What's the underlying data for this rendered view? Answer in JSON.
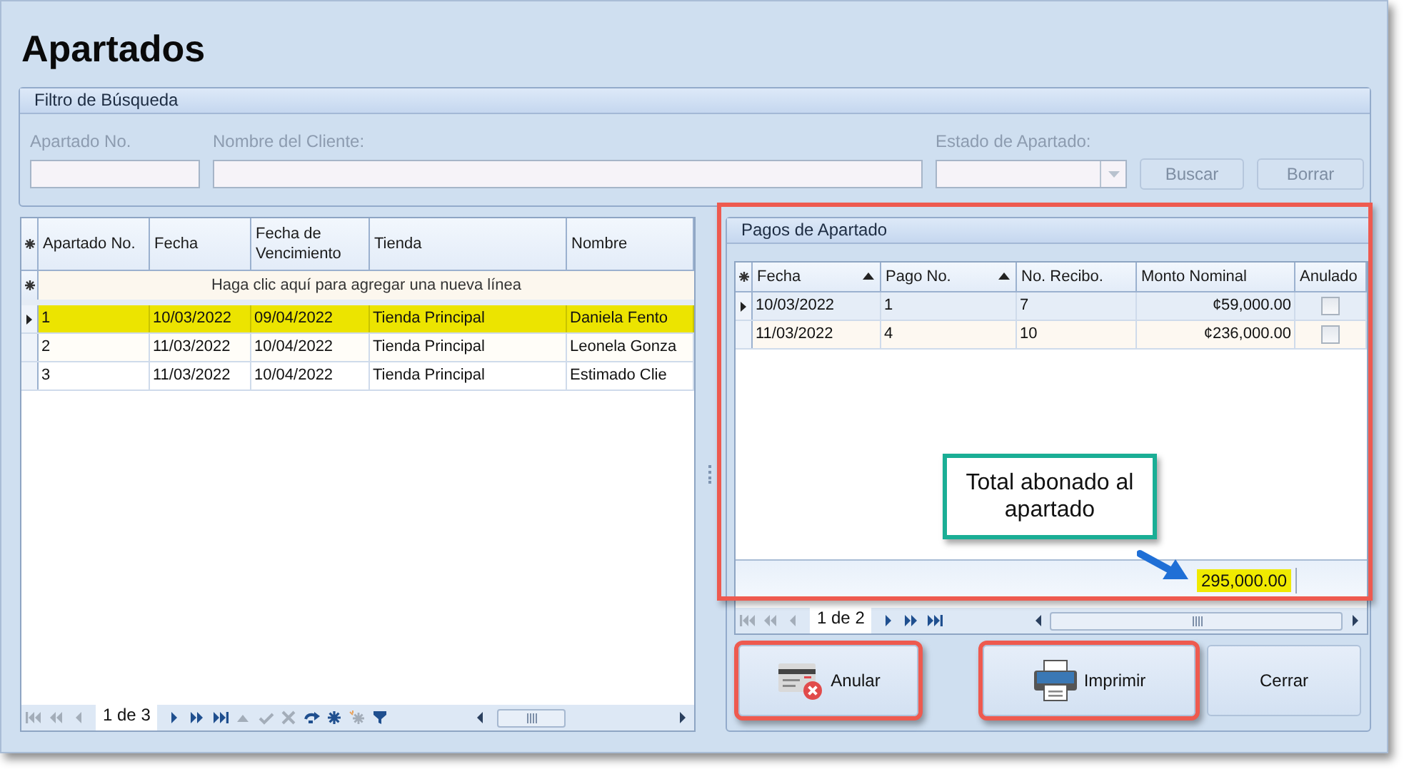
{
  "window": {
    "title": "Apartados"
  },
  "filter": {
    "title": "Filtro de Búsqueda",
    "fields": [
      {
        "label": "Apartado No.",
        "kind": "text",
        "disabled": true
      },
      {
        "label": "Nombre del Cliente:",
        "kind": "text",
        "disabled": true
      },
      {
        "label": "Estado de Apartado:",
        "kind": "dropdown",
        "disabled": true
      }
    ],
    "buttons": [
      {
        "label": "Buscar",
        "disabled": true
      },
      {
        "label": "Borrar",
        "disabled": true
      }
    ]
  },
  "apartados": {
    "columns": [
      {
        "label": "Apartado No."
      },
      {
        "label": "Fecha"
      },
      {
        "label": "Fecha de Vencimiento"
      },
      {
        "label": "Tienda"
      },
      {
        "label": "Nombre"
      }
    ],
    "new_row_hint": "Haga clic aquí para agregar una nueva línea",
    "rows": [
      {
        "cells": [
          "1",
          "10/03/2022",
          "09/04/2022",
          "Tienda Principal",
          "Daniela Fento"
        ],
        "selected": true
      },
      {
        "cells": [
          "2",
          "11/03/2022",
          "10/04/2022",
          "Tienda Principal",
          "Leonela Gonza"
        ],
        "selected": false
      },
      {
        "cells": [
          "3",
          "11/03/2022",
          "10/04/2022",
          "Tienda Principal",
          "Estimado Clie"
        ],
        "selected": false
      }
    ],
    "pager": "1 de 3"
  },
  "pagos": {
    "title": "Pagos de Apartado",
    "annotated": true,
    "columns": [
      {
        "label": "Fecha",
        "sorted": true
      },
      {
        "label": "Pago No.",
        "sorted": true
      },
      {
        "label": "No. Recibo.",
        "sorted": false
      },
      {
        "label": "Monto Nominal",
        "sorted": false
      },
      {
        "label": "Anulado",
        "sorted": false
      }
    ],
    "rows": [
      {
        "fecha": "10/03/2022",
        "pago": "1",
        "recibo": "7",
        "monto": "¢59,000.00",
        "anulado": false,
        "selected": true
      },
      {
        "fecha": "11/03/2022",
        "pago": "4",
        "recibo": "10",
        "monto": "¢236,000.00",
        "anulado": false,
        "selected": false
      }
    ],
    "total": "295,000.00",
    "total_highlighted": true,
    "pager": "1 de 2"
  },
  "callout": {
    "text": "Total abonado al apartado"
  },
  "actions": [
    {
      "label": "Anular",
      "kind": "void",
      "annotated": true
    },
    {
      "label": "Imprimir",
      "kind": "print",
      "annotated": true
    },
    {
      "label": "Cerrar",
      "kind": "plain",
      "annotated": false
    }
  ]
}
